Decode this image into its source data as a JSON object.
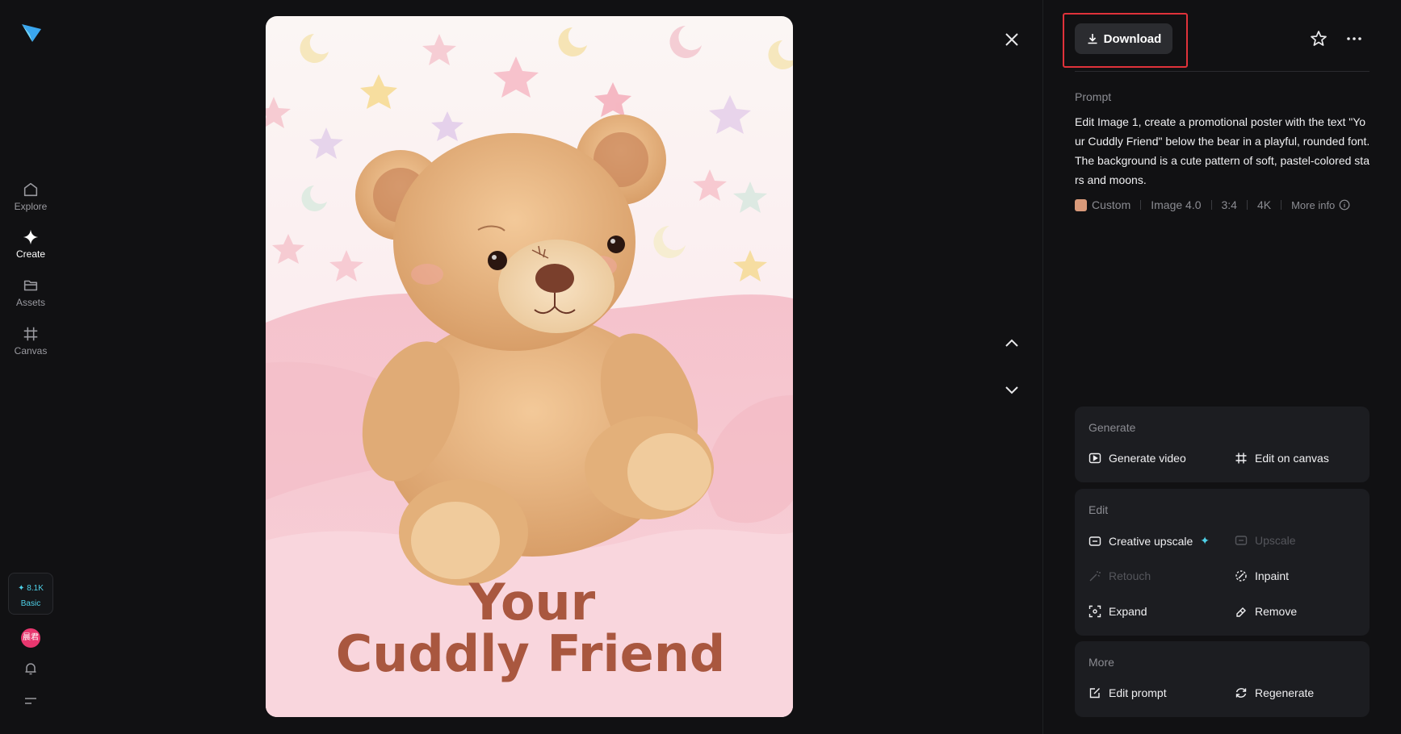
{
  "sidebar": {
    "logo": "paper-plane-logo",
    "items": [
      {
        "label": "Explore",
        "icon": "home-icon",
        "active": false
      },
      {
        "label": "Create",
        "icon": "sparkle-icon",
        "active": true
      },
      {
        "label": "Assets",
        "icon": "folder-icon",
        "active": false
      },
      {
        "label": "Canvas",
        "icon": "canvas-icon",
        "active": false
      }
    ],
    "credits": {
      "amount": "8.1K",
      "plan": "Basic"
    },
    "avatar_text": "晨君"
  },
  "poster": {
    "line1": "Your",
    "line2": "Cuddly Friend"
  },
  "panel": {
    "download_label": "Download",
    "prompt_title": "Prompt",
    "prompt_text": "Edit Image 1, create a promotional poster with the text \"Your Cuddly Friend\" below the bear in a playful, rounded font. The background is a cute pattern of soft, pastel-colored stars and moons.",
    "meta": {
      "style": "Custom",
      "model": "Image 4.0",
      "ratio": "3:4",
      "resolution": "4K",
      "more_info": "More info"
    },
    "generate": {
      "title": "Generate",
      "actions": [
        "Generate video",
        "Edit on canvas"
      ]
    },
    "edit": {
      "title": "Edit",
      "actions": [
        "Creative upscale",
        "Upscale",
        "Retouch",
        "Inpaint",
        "Expand",
        "Remove"
      ]
    },
    "more": {
      "title": "More",
      "actions": [
        "Edit prompt",
        "Regenerate"
      ]
    }
  },
  "colors": {
    "accent": "#4fd1e8",
    "highlight_border": "#e0323a",
    "background": "#111113",
    "card": "#1c1d21"
  }
}
